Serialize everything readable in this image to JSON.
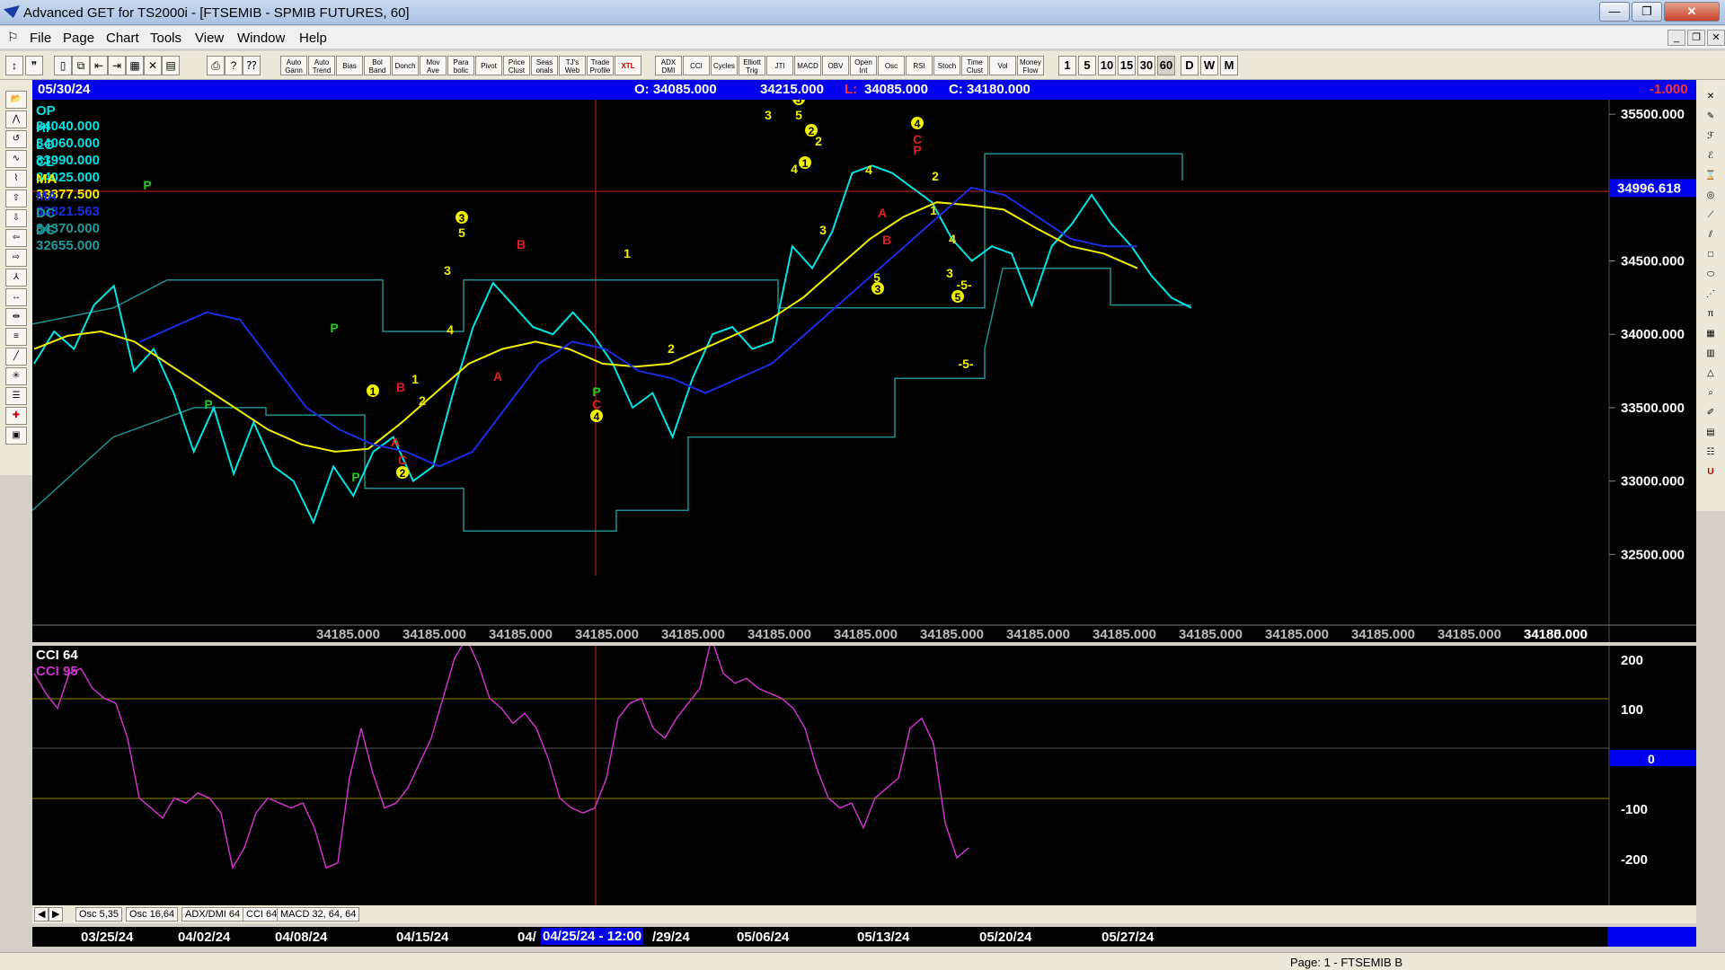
{
  "window": {
    "title": "Advanced GET for TS2000i - [FTSEMIB - SPMIB FUTURES, 60]",
    "btn_min": "—",
    "btn_max": "❐",
    "btn_close": "✕"
  },
  "menu": {
    "items": [
      "File",
      "Page",
      "Chart",
      "Tools",
      "View",
      "Window",
      "Help"
    ]
  },
  "toolbar": {
    "studies": [
      "Auto Gann",
      "Auto Trend",
      "Bias",
      "Bol Band",
      "Donch",
      "Mov Ave",
      "Para bolic",
      "Pivot",
      "Price Clust",
      "Seas onals",
      "TJ's Web",
      "Trade Profile",
      "XTL",
      "ADX DMI",
      "CCI",
      "Cycles",
      "Elliott Trig",
      "JTI",
      "MACD",
      "OBV",
      "Open Int",
      "Osc",
      "RSI",
      "Stoch",
      "Time Clust",
      "Vol",
      "Money Flow"
    ],
    "periods": [
      "1",
      "5",
      "10",
      "15",
      "30",
      "60",
      "D",
      "W",
      "M"
    ],
    "active_period": "60"
  },
  "header": {
    "date": "05/30/24",
    "open": "O: 34085.000",
    "high": "34215.000",
    "low_label": "L:",
    "low": "34085.000",
    "close": "C: 34180.000",
    "change": "-1.000"
  },
  "legend": [
    {
      "label": "OP  34040.000",
      "color": "#00e0e0"
    },
    {
      "label": "HI   34060.000",
      "color": "#00e0e0"
    },
    {
      "label": "LO  33990.000",
      "color": "#00e0e0"
    },
    {
      "label": "CL  34025.000",
      "color": "#00e0e0"
    },
    {
      "label": "MA  33877.500",
      "color": "#f0f000"
    },
    {
      "label": "MA  33821.563",
      "color": "#1a2ee0"
    },
    {
      "label": "DC  34370.000",
      "color": "#1f9a9a"
    },
    {
      "label": "DC  32655.000",
      "color": "#1f9a9a"
    }
  ],
  "price_axis": {
    "ticks": [
      "35500.000",
      "34500.000",
      "34000.000",
      "33500.000",
      "33000.000",
      "32500.000"
    ],
    "marker": "34996.618"
  },
  "bottom_values": [
    "34185.000",
    "34185.000",
    "34185.000",
    "34185.000",
    "34185.000",
    "34185.000",
    "34185.000",
    "34185.000",
    "34185.000",
    "34185.000",
    "34185.000",
    "34185.000",
    "34185.000",
    "34185.000",
    "34185.000"
  ],
  "bottom_last": "34180.000",
  "cci": {
    "title1": "CCI 64",
    "title2": "CCI  95",
    "ticks": [
      "200",
      "100",
      "-100",
      "-200"
    ],
    "zero_label": "0"
  },
  "tabs": [
    "Osc 5,35",
    "Osc 16,64",
    "ADX/DMI 64",
    "CCI 64",
    "MACD 32, 64, 64"
  ],
  "active_tab": "CCI 64",
  "dates": [
    "03/25/24",
    "04/02/24",
    "04/08/24",
    "04/15/24",
    "04/",
    "/29/24",
    "05/06/24",
    "05/13/24",
    "05/20/24",
    "05/27/24"
  ],
  "date_highlight": "04/25/24 - 12:00",
  "status": "Page: 1 - FTSEMIB B",
  "colors": {
    "price": "#00e5e5",
    "ma_yellow": "#f0f000",
    "ma_blue": "#1a2ee0",
    "donchian": "#1f8f8f",
    "cci": "#cc33cc",
    "wave_yellow": "#f0f000",
    "wave_red": "#e02020",
    "pivot_green": "#22cc22",
    "header_bg": "#0000ee",
    "hline": "#cc2222"
  },
  "chart_data": {
    "type": "line",
    "title": "FTSEMIB - SPMIB FUTURES, 60",
    "ylim": [
      32000,
      35550
    ],
    "x_labels": [
      "03/25/24",
      "04/02/24",
      "04/08/24",
      "04/15/24",
      "04/25/24",
      "04/29/24",
      "05/06/24",
      "05/13/24",
      "05/20/24",
      "05/27/24"
    ],
    "series": [
      {
        "name": "CL",
        "values": [
          33800,
          34020,
          33900,
          34200,
          34330,
          33750,
          33900,
          33600,
          33200,
          33500,
          33050,
          33400,
          33100,
          33000,
          32720,
          33100,
          32900,
          33200,
          33300,
          33000,
          33100,
          33600,
          34050,
          34350,
          34200,
          34050,
          34000,
          34150,
          34000,
          33800,
          33500,
          33600,
          33300,
          33700,
          34000,
          34050,
          33900,
          33950,
          34600,
          34450,
          34700,
          35100,
          35150,
          35100,
          35000,
          34900,
          34650,
          34500,
          34600,
          34550,
          34200,
          34600,
          34750,
          34950,
          34750,
          34600,
          34400,
          34250,
          34180
        ]
      },
      {
        "name": "MA",
        "values": [
          33900,
          33990,
          34020,
          33950,
          33800,
          33650,
          33500,
          33350,
          33250,
          33200,
          33220,
          33400,
          33600,
          33800,
          33900,
          33950,
          33900,
          33800,
          33780,
          33800,
          33900,
          34000,
          34100,
          34250,
          34450,
          34650,
          34800,
          34900,
          34880,
          34850,
          34720,
          34600,
          34550,
          34450
        ]
      },
      {
        "name": "MA",
        "values": [
          33950,
          34050,
          34150,
          34100,
          33800,
          33500,
          33350,
          33250,
          33200,
          33100,
          33200,
          33500,
          33800,
          33950,
          33900,
          33750,
          33700,
          33600,
          33700,
          33800,
          34000,
          34200,
          34400,
          34600,
          34800,
          35000,
          34950,
          34800,
          34650,
          34600,
          34600
        ]
      }
    ]
  }
}
